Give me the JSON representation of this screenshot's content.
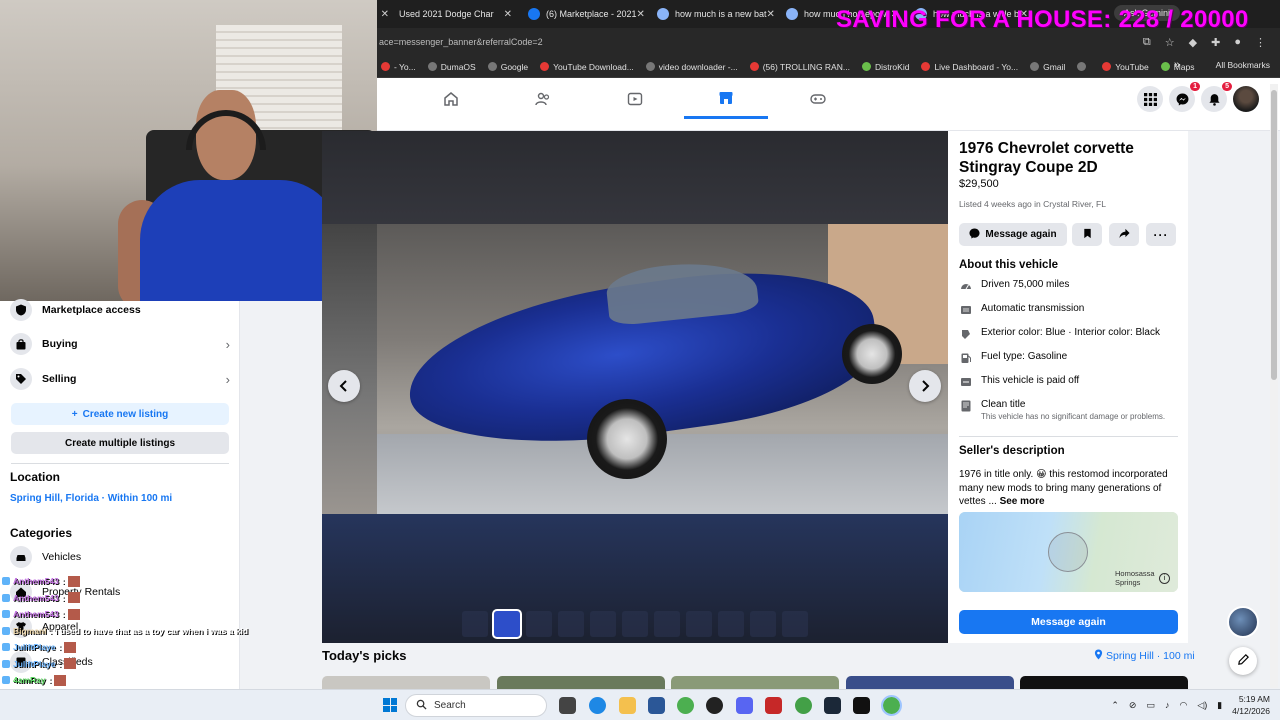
{
  "overlay": {
    "goal_text": "SAVING FOR A HOUSE: 228 / 20000"
  },
  "browser": {
    "tabs": [
      {
        "label": "Used 2021 Dodge Char",
        "icon": "tab-icon"
      },
      {
        "label": "(6) Marketplace - 2021",
        "icon": "facebook-icon"
      },
      {
        "label": "how much is a new bat",
        "icon": "google-icon"
      },
      {
        "label": "how much horsepow",
        "icon": "google-icon"
      },
      {
        "label": "how much is a wide b",
        "icon": "google-icon"
      }
    ],
    "ask_gemini": "Ask Gemini",
    "url": "ace=messenger_banner&referralCode=2",
    "bookmarks": [
      {
        "label": "- Yo...",
        "color": "#e53935"
      },
      {
        "label": "DumaOS",
        "color": "#777777"
      },
      {
        "label": "Google",
        "color": "#777777"
      },
      {
        "label": "YouTube Download...",
        "color": "#e53935"
      },
      {
        "label": "video downloader -...",
        "color": "#777777"
      },
      {
        "label": "(56) TROLLING RAN...",
        "color": "#e53935"
      },
      {
        "label": "DistroKid",
        "color": "#6abf4b"
      },
      {
        "label": "Live Dashboard - Yo...",
        "color": "#e53935"
      },
      {
        "label": "Gmail",
        "color": "#777777"
      },
      {
        "label": "",
        "color": "#777777"
      },
      {
        "label": "YouTube",
        "color": "#e53935"
      },
      {
        "label": "Maps",
        "color": "#6abf4b"
      }
    ],
    "all_bookmarks": "All Bookmarks"
  },
  "fb_nav": {
    "icons": [
      "home-icon",
      "friends-icon",
      "video-icon",
      "marketplace-icon",
      "gaming-icon"
    ],
    "active": "marketplace-icon",
    "messenger_badge": "1",
    "notifications_badge": "5"
  },
  "sidebar": {
    "items": [
      {
        "label": "Marketplace access",
        "icon": "shield-icon"
      },
      {
        "label": "Buying",
        "icon": "bag-icon"
      },
      {
        "label": "Selling",
        "icon": "tag-icon"
      }
    ],
    "create_listing": "Create new listing",
    "create_multiple": "Create multiple listings",
    "location_heading": "Location",
    "location_value": "Spring Hill, Florida · Within 100 mi",
    "categories_heading": "Categories",
    "categories": [
      "Vehicles",
      "Property Rentals",
      "Apparel",
      "Classifieds"
    ]
  },
  "chat": [
    {
      "user": "Anthem543",
      "msg": "",
      "color": "#c06ee0"
    },
    {
      "user": "Anthem543",
      "msg": "",
      "color": "#c06ee0"
    },
    {
      "user": "Anthem543",
      "msg": "",
      "color": "#c06ee0"
    },
    {
      "user": "Bigmanl",
      "msg": "i used to have that as a toy car when i was a kid",
      "color": "#e9d2a6"
    },
    {
      "user": "JuliftPlaye",
      "msg": "",
      "color": "#6fb7ff"
    },
    {
      "user": "JuliftPlaye",
      "msg": "",
      "color": "#6fb7ff"
    },
    {
      "user": "4amRay",
      "msg": "",
      "color": "#5ad860"
    },
    {
      "user": "4amRay",
      "msg": "",
      "color": "#5ad860"
    }
  ],
  "listing": {
    "title": "1976 Chevrolet corvette Stingray Coupe 2D",
    "price": "$29,500",
    "meta": "Listed 4 weeks ago in Crystal River, FL",
    "message_again_small": "Message again",
    "about_heading": "About this vehicle",
    "details": [
      {
        "text": "Driven 75,000 miles",
        "icon": "speedometer-icon",
        "sub": ""
      },
      {
        "text": "Automatic transmission",
        "icon": "transmission-icon",
        "sub": ""
      },
      {
        "text": "Exterior color: Blue · Interior color: Black",
        "icon": "paint-icon",
        "sub": ""
      },
      {
        "text": "Fuel type: Gasoline",
        "icon": "fuel-icon",
        "sub": ""
      },
      {
        "text": "This vehicle is paid off",
        "icon": "car-icon",
        "sub": ""
      },
      {
        "text": "Clean title",
        "icon": "document-icon",
        "sub": "This vehicle has no significant damage or problems."
      }
    ],
    "seller_heading": "Seller's description",
    "seller_desc": "1976 in title only. 😀 this restomod incorporated many new mods to bring many generations of vettes ...",
    "see_more": "See more",
    "map_label": "Homosassa Springs",
    "message_again_primary": "Message again",
    "thumbnail_count": 11,
    "active_thumbnail": 2
  },
  "picks": {
    "heading": "Today's picks",
    "location": "Spring Hill · 100 mi"
  },
  "taskbar": {
    "search_placeholder": "Search",
    "time": "5:19 AM",
    "date": "4/12/2026"
  }
}
